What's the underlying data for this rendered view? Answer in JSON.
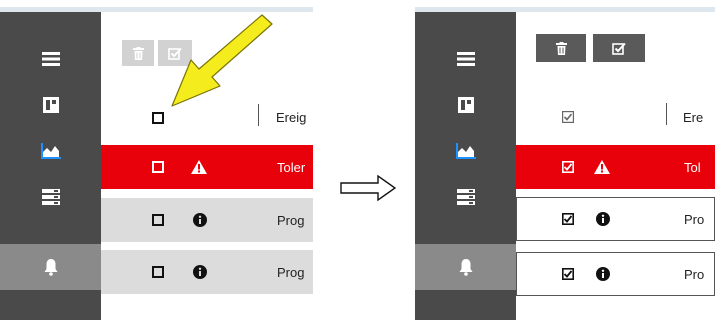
{
  "header": {
    "column_label_left": "Ereig",
    "column_label_right": "Ere"
  },
  "rows_left": [
    {
      "type": "warning",
      "text": "Toler"
    },
    {
      "type": "info",
      "text": "Prog"
    },
    {
      "type": "info",
      "text": "Prog"
    }
  ],
  "rows_right": [
    {
      "type": "warning",
      "text": "Tol"
    },
    {
      "type": "info",
      "text": "Pro"
    },
    {
      "type": "info",
      "text": "Pro"
    }
  ],
  "sidebar_items": [
    "menu-icon",
    "dashboard-icon",
    "chart-icon",
    "list-icon",
    "bell-icon"
  ],
  "toolbar_buttons": [
    "delete-icon",
    "check-all-icon"
  ],
  "colors": {
    "sidebar": "#4a4a4a",
    "sidebar_active": "#8a8a8a",
    "alert_row": "#e8000b",
    "info_row": "#dcdcdc",
    "annotation_arrow": "#f5ec1e"
  }
}
